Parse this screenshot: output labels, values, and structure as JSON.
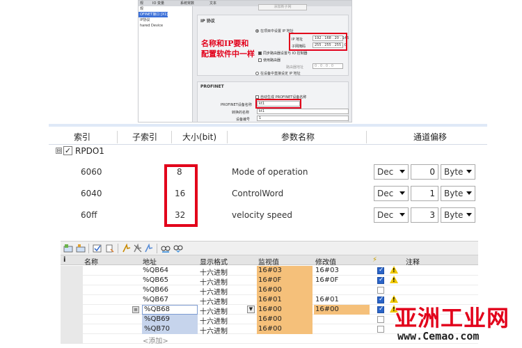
{
  "top_screenshot": {
    "tabs": [
      "规",
      "IO 变量",
      "系统常数",
      "文本"
    ],
    "tree_items": [
      "规",
      "OFINET接口 [X1]",
      "IP协议",
      "hared Device"
    ],
    "add_subnet_label": "添加新子网",
    "ip_section_title": "IP 协议",
    "radio_set_ip_in_project": "在项目中设置 IP 地址",
    "ip_address_label": "IP 地址",
    "ip_address_value": "192 . 168 . 20 . 145",
    "subnet_mask_label": "子网掩码",
    "subnet_mask_value": "255 . 255 . 255 . 0",
    "sync_router_label": "同步路由器设置与 IO 控制器",
    "use_router_label": "使用路由器",
    "router_address_label": "路由器地址",
    "router_address_value": "0 . 0 . 0 . 0",
    "radio_set_ip_on_device": "在设备中直接设定 IP 地址",
    "profinet_title": "PROFINET",
    "auto_generate_label": "自动生成 PROFINET设备名称",
    "device_name_label": "PROFINET设备名称",
    "device_name_value": "kt1",
    "converted_name_label": "转换的名称",
    "converted_name_value": "kt1",
    "device_number_label": "设备编号",
    "device_number_value": "1",
    "annotation_line1": "名称和IP要和",
    "annotation_line2": "配置软件中一样"
  },
  "pdo_table": {
    "headers": [
      "索引",
      "子索引",
      "大小(bit)",
      "参数名称",
      "通道偏移"
    ],
    "group_toggle": "⊟",
    "group_checked": "✓",
    "group_label": "RPDO1",
    "rows": [
      {
        "index": "6060",
        "size": "8",
        "name": "Mode of operation",
        "format": "Dec",
        "offset": "0",
        "unit": "Byte"
      },
      {
        "index": "6040",
        "size": "16",
        "name": "ControlWord",
        "format": "Dec",
        "offset": "1",
        "unit": "Byte"
      },
      {
        "index": "60ff",
        "size": "32",
        "name": "velocity speed",
        "format": "Dec",
        "offset": "3",
        "unit": "Byte"
      }
    ]
  },
  "watch_table": {
    "headers": {
      "idx": "i",
      "name": "名称",
      "address": "地址",
      "display_format": "显示格式",
      "monitor_value": "监视值",
      "modify_value": "修改值",
      "lightning": "⚡",
      "comment": "注释"
    },
    "rows": [
      {
        "address": "%QB64",
        "format": "十六进制",
        "monitor": "16#03",
        "modify": "16#03",
        "checked": true,
        "warn": true
      },
      {
        "address": "%QB65",
        "format": "十六进制",
        "monitor": "16#0F",
        "modify": "16#0F",
        "checked": true,
        "warn": true
      },
      {
        "address": "%QB66",
        "format": "十六进制",
        "monitor": "16#00",
        "modify": "",
        "checked": false,
        "warn": false
      },
      {
        "address": "%QB67",
        "format": "十六进制",
        "monitor": "16#01",
        "modify": "16#01",
        "checked": true,
        "warn": true
      },
      {
        "address": "%QB68",
        "format": "十六进制",
        "monitor": "16#00",
        "modify": "16#00",
        "checked": true,
        "warn": true
      },
      {
        "address": "%QB69",
        "format": "十六进制",
        "monitor": "16#00",
        "modify": "",
        "checked": false,
        "warn": false
      },
      {
        "address": "%QB70",
        "format": "十六进制",
        "monitor": "16#00",
        "modify": "",
        "checked": false,
        "warn": false
      }
    ],
    "add_row_label": "<添加>"
  },
  "watermark": {
    "logo_text": "亚洲工业网",
    "url": "www.Cemao.com"
  },
  "colors": {
    "highlight_red": "#e2001a",
    "monitor_orange": "#f5c07a",
    "selection_blue": "#c6d4ec"
  }
}
